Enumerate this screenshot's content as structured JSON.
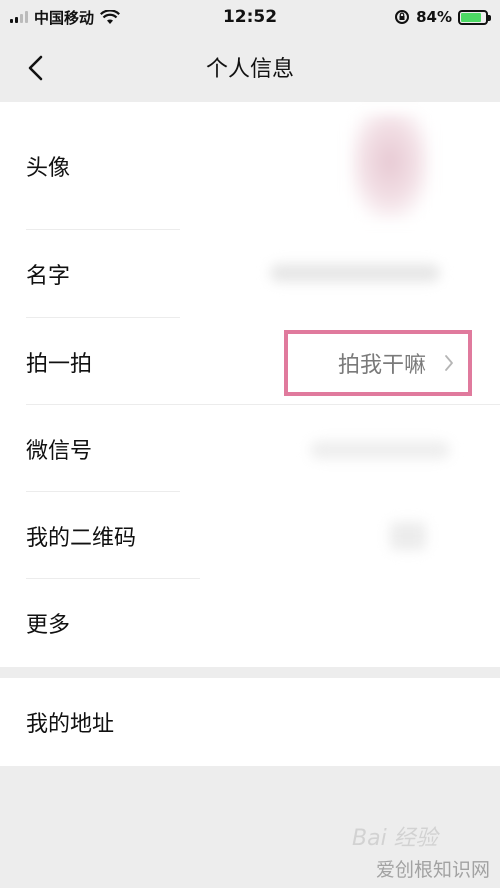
{
  "status_bar": {
    "carrier": "中国移动",
    "time": "12:52",
    "battery_text": "84%",
    "battery_level": 0.84,
    "icons": [
      "signal-icon",
      "wifi-icon",
      "rotation-lock-icon",
      "battery-icon"
    ]
  },
  "nav": {
    "title": "个人信息",
    "back_icon": "chevron-left-icon"
  },
  "rows": {
    "avatar": "头像",
    "name": "名字",
    "pat": "拍一拍",
    "pat_value": "拍我干嘛",
    "wechat_id": "微信号",
    "qr_code": "我的二维码",
    "more": "更多",
    "address": "我的地址"
  },
  "watermark": {
    "baidu": "Bai 经验",
    "site": "爱创根知识网"
  },
  "colors": {
    "highlight_border": "#e07a9d",
    "battery_green": "#4cd964",
    "background": "#ededed"
  }
}
